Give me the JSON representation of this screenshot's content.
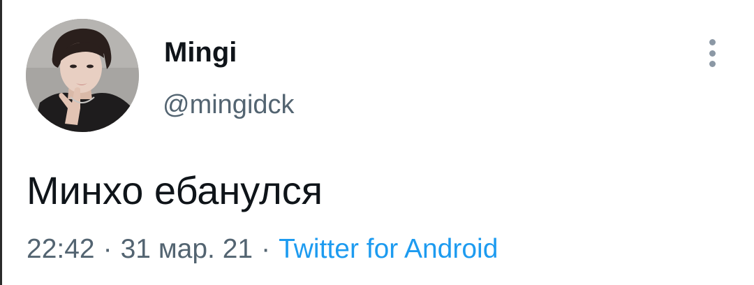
{
  "author": {
    "display_name": "Mingi",
    "username": "@mingidck"
  },
  "tweet": {
    "text": "Минхо ебанулся",
    "time": "22:42",
    "date": "31 мар. 21",
    "separator": "·",
    "source": "Twitter for Android"
  },
  "icons": {
    "more": "more-vertical-icon"
  },
  "colors": {
    "text_primary": "#0f1419",
    "text_secondary": "#536471",
    "link": "#1d9bf0",
    "background": "#ffffff"
  }
}
